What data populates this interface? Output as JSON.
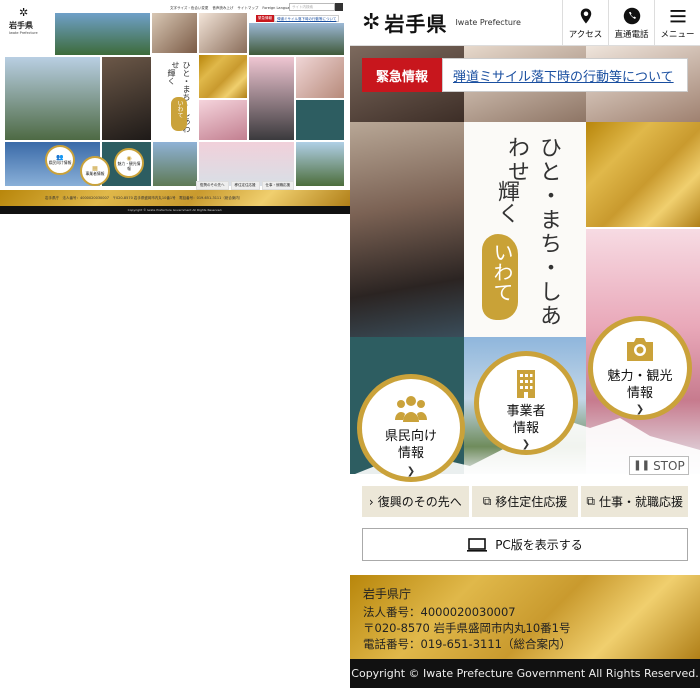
{
  "brand": {
    "name": "岩手県",
    "sub": "Iwate Prefecture"
  },
  "desktop": {
    "utility": [
      "文字サイズ・色合い変更",
      "音声読み上げ",
      "サイトマップ",
      "Foreign Language",
      "サイトの使い方"
    ],
    "search_placeholder": "サイト内検索",
    "emergency": {
      "label": "緊急情報",
      "text": "弾道ミサイル落下時の行動等について"
    },
    "catch_line1": "ひと・まち・しあわせ",
    "catch_line2": "輝く",
    "catch_line3": "いわて",
    "circles": [
      "県民向け情報",
      "事業者情報",
      "魅力・観光情報"
    ],
    "bottom_links": [
      "復興のその先へ",
      "移住定住応援",
      "仕事・就職応援"
    ],
    "footer_text": "岩手県庁　法人番号：4000020030007　〒020-8570 岩手県盛岡市内丸10番1号　電話番号：019-651-3111（総合案内）",
    "copyright": "Copyright © Iwate Prefecture Government All Rights Reserved."
  },
  "mobile": {
    "nav": [
      {
        "label": "アクセス",
        "icon": "map-pin-icon"
      },
      {
        "label": "直通電話",
        "icon": "phone-icon"
      },
      {
        "label": "メニュー",
        "icon": "menu-icon"
      }
    ],
    "emergency": {
      "label": "緊急情報",
      "text": "弾道ミサイル落下時の行動等について"
    },
    "catch": {
      "line1": "ひと・まち・しあわせ",
      "line2": "輝く",
      "line3": "いわて"
    },
    "circles": {
      "residents": "県民向け\n情報",
      "business": "事業者\n情報",
      "tourism": "魅力・観光\n情報"
    },
    "stop_label": "STOP",
    "links": [
      "復興のその先へ",
      "移住定住応援",
      "仕事・就職応援"
    ],
    "pc_label": "PC版を表示する",
    "footer": {
      "org": "岩手県庁",
      "corp_no": "法人番号：4000020030007",
      "address": "〒020-8570 岩手県盛岡市内丸10番1号",
      "phone": "電話番号：019-651-3111（総合案内）"
    },
    "copyright": "Copyright © Iwate Prefecture Government All Rights Reserved."
  },
  "colors": {
    "gold": "#caa23a",
    "emergency_red": "#c8161d",
    "link_blue": "#1a4fa0"
  }
}
